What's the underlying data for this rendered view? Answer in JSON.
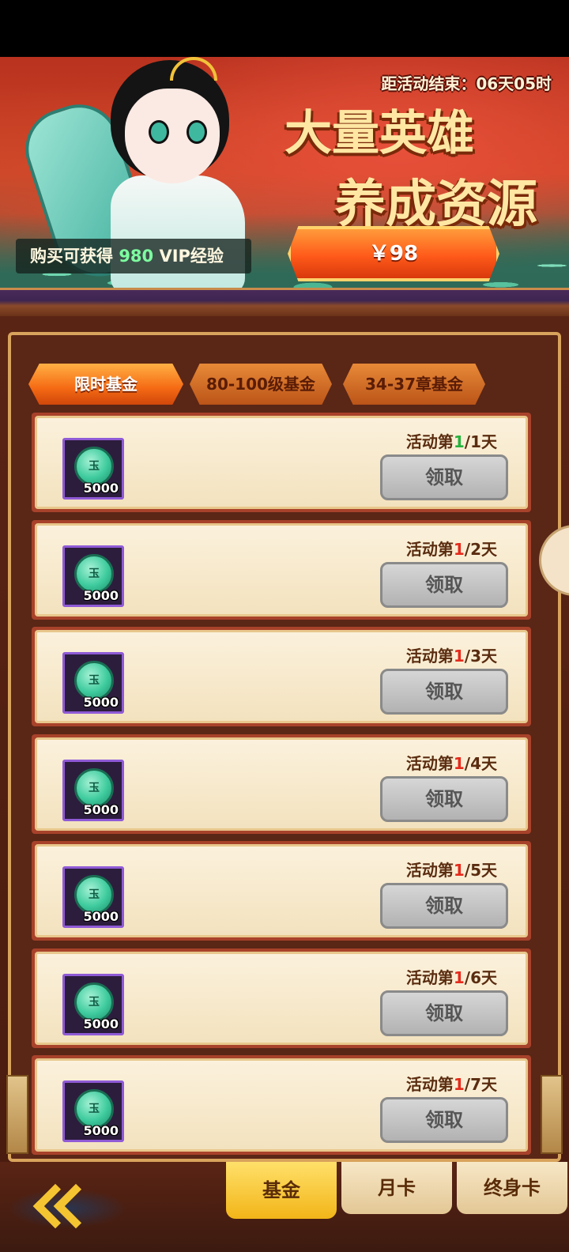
{
  "banner": {
    "countdown": "距活动结束：06天05时",
    "headline_line1": "大量英雄",
    "headline_line2": "养成资源",
    "vip_prefix": "购买可获得",
    "vip_amount": "980",
    "vip_suffix": "VIP经验",
    "price_label": "￥98"
  },
  "tabs": [
    {
      "label": "限时基金",
      "active": true
    },
    {
      "label": "80-100级基金",
      "active": false
    },
    {
      "label": "34-37章基金",
      "active": false
    }
  ],
  "rewards": [
    {
      "day_prefix": "活动第",
      "day_current": "1",
      "day_suffix": "/1天",
      "current_color": "#27b23f",
      "item_symbol": "玉",
      "item_qty": "5000",
      "claim_label": "领取"
    },
    {
      "day_prefix": "活动第",
      "day_current": "1",
      "day_suffix": "/2天",
      "current_color": "#e52b1d",
      "item_symbol": "玉",
      "item_qty": "5000",
      "claim_label": "领取"
    },
    {
      "day_prefix": "活动第",
      "day_current": "1",
      "day_suffix": "/3天",
      "current_color": "#e52b1d",
      "item_symbol": "玉",
      "item_qty": "5000",
      "claim_label": "领取"
    },
    {
      "day_prefix": "活动第",
      "day_current": "1",
      "day_suffix": "/4天",
      "current_color": "#e52b1d",
      "item_symbol": "玉",
      "item_qty": "5000",
      "claim_label": "领取"
    },
    {
      "day_prefix": "活动第",
      "day_current": "1",
      "day_suffix": "/5天",
      "current_color": "#e52b1d",
      "item_symbol": "玉",
      "item_qty": "5000",
      "claim_label": "领取"
    },
    {
      "day_prefix": "活动第",
      "day_current": "1",
      "day_suffix": "/6天",
      "current_color": "#e52b1d",
      "item_symbol": "玉",
      "item_qty": "5000",
      "claim_label": "领取"
    },
    {
      "day_prefix": "活动第",
      "day_current": "1",
      "day_suffix": "/7天",
      "current_color": "#e52b1d",
      "item_symbol": "玉",
      "item_qty": "5000",
      "claim_label": "领取"
    }
  ],
  "bottom_nav": [
    {
      "label": "基金",
      "active": true
    },
    {
      "label": "月卡",
      "active": false
    },
    {
      "label": "终身卡",
      "active": false
    }
  ],
  "colors": {
    "accent_orange": "#f56a14",
    "claim_disabled": "#b2b2b2",
    "vip_green": "#7dffa0"
  }
}
